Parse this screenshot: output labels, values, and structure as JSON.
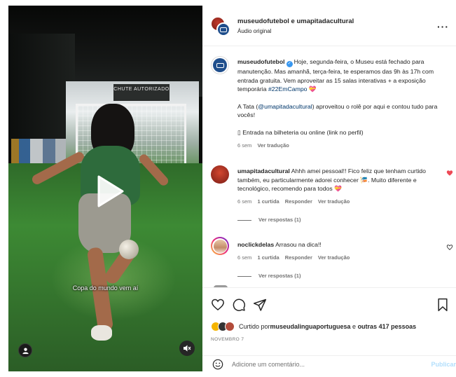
{
  "video": {
    "sign_text": "CHUTE AUTORIZADO",
    "caption": "Copa do mundo vem aí"
  },
  "header": {
    "title": "museudofutebol e umapitadacultural",
    "subtitle": "Áudio original",
    "more": "···"
  },
  "caption_post": {
    "username": "museudofutebol",
    "text_1": "Hoje, segunda-feira, o Museu está fechado para manutenção. Mas amanhã, terça-feira, te esperamos das 9h às 17h com entrada gratuita. Vem aproveitar as 15 salas interativas + a exposição temporária ",
    "hashtag": "#22EmCampo",
    "text_1_end": " 💝",
    "text_2_a": "A Tata (",
    "mention": "@umapitadacultural",
    "text_2_b": ") aproveitou o rolê por aqui e contou tudo para vocês!",
    "text_3": "▯ Entrada na bilheteria ou online (link no perfil)",
    "time": "6 sem",
    "translate": "Ver tradução"
  },
  "comments": [
    {
      "username": "umapitadacultural",
      "text": "Ahhh amei pessoal!! Fico feliz que tenham curtido também, eu particularmente adorei conhecer 🎏. Muito diferente e tecnológico, recomendo para todos 💝",
      "time": "6 sem",
      "likes": "1 curtida",
      "reply": "Responder",
      "translate": "Ver tradução",
      "view_replies": "Ver respostas (1)"
    },
    {
      "username": "noclickdelas",
      "text": "Arrasou na dica!!",
      "time": "6 sem",
      "likes": "1 curtida",
      "reply": "Responder",
      "translate": "Ver tradução",
      "view_replies": "Ver respostas (1)"
    }
  ],
  "likes": {
    "prefix": "Curtido por ",
    "user": "museudalinguaportuguesa",
    "middle": " e ",
    "others": "outras 417 pessoas"
  },
  "date": "NOVEMBRO 7",
  "comment_box": {
    "placeholder": "Adicione um comentário...",
    "post": "Publicar"
  },
  "colors": {
    "link": "#00376b",
    "meta": "#737373",
    "verified": "#3897f0",
    "liked": "#ed4956",
    "post_disabled": "#b2dffc"
  }
}
